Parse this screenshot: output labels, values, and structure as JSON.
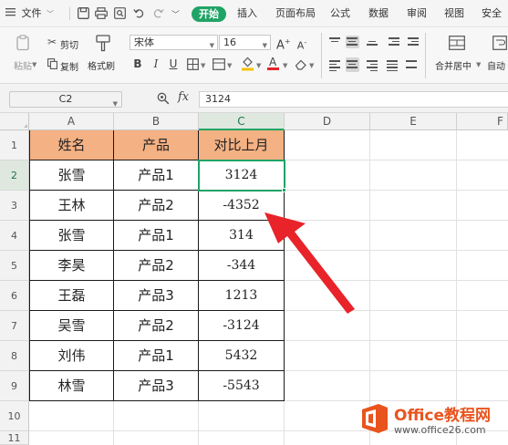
{
  "menubar": {
    "file_label": "文件",
    "tabs": [
      "开始",
      "插入",
      "页面布局",
      "公式",
      "数据",
      "审阅",
      "视图",
      "安全"
    ]
  },
  "ribbon": {
    "paste_label": "粘贴",
    "cut_label": "剪切",
    "copy_label": "复制",
    "format_painter_label": "格式刷",
    "font_name": "宋体",
    "font_size": "16",
    "grow_font": "A",
    "shrink_font": "A",
    "bold": "B",
    "italic": "I",
    "underline": "U",
    "font_color_letter": "A",
    "merge_center_label": "合并居中",
    "auto_wrap_label": "自动"
  },
  "formula_bar": {
    "cell_ref": "C2",
    "fx_label": "fx",
    "value": "3124"
  },
  "columns": [
    "A",
    "B",
    "C",
    "D",
    "E",
    "F"
  ],
  "rows": [
    "1",
    "2",
    "3",
    "4",
    "5",
    "6",
    "7",
    "8",
    "9",
    "10",
    "11"
  ],
  "table": {
    "headers": [
      "姓名",
      "产品",
      "对比上月"
    ],
    "rows": [
      [
        "张雪",
        "产品1",
        "3124"
      ],
      [
        "王林",
        "产品2",
        "-4352"
      ],
      [
        "张雪",
        "产品1",
        "314"
      ],
      [
        "李昊",
        "产品2",
        "-344"
      ],
      [
        "王磊",
        "产品3",
        "1213"
      ],
      [
        "吴雪",
        "产品2",
        "-3124"
      ],
      [
        "刘伟",
        "产品1",
        "5432"
      ],
      [
        "林雪",
        "产品3",
        "-5543"
      ]
    ]
  },
  "watermark": {
    "brand": "Office教程网",
    "url": "www.office26.com"
  },
  "colors": {
    "accent": "#21a366",
    "header_fill": "#f4b183",
    "arrow": "#e8232a",
    "watermark_orange": "#e9541e"
  }
}
